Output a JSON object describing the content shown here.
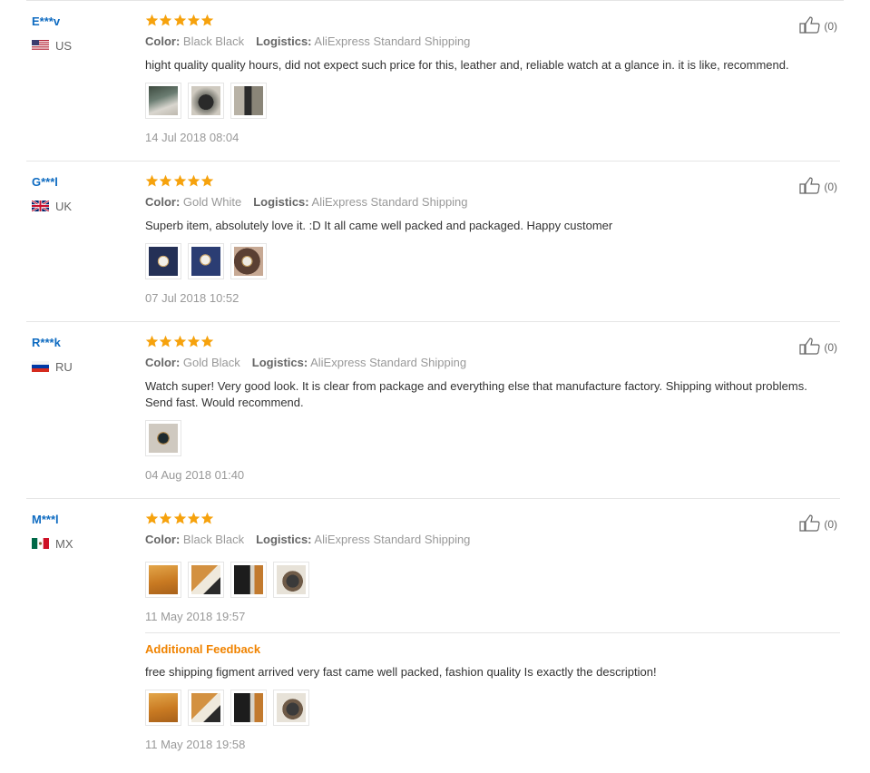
{
  "labels": {
    "color": "Color:",
    "logistics": "Logistics:",
    "additional_feedback": "Additional Feedback"
  },
  "colors": {
    "star": "#f6a20d",
    "username": "#0e6bc1",
    "accent": "#f08300"
  },
  "reviews": [
    {
      "user": "E***v",
      "country": "US",
      "flag": "us-flag-icon",
      "rating": 5,
      "color": "Black Black",
      "logistics": "AliExpress Standard Shipping",
      "text": "hight quality quality hours, did not expect such price for this, leather and, reliable watch at a glance in. it is like, recommend.",
      "thumb_count": 3,
      "date": "14 Jul 2018 08:04",
      "helpful": "(0)"
    },
    {
      "user": "G***l",
      "country": "UK",
      "flag": "uk-flag-icon",
      "rating": 5,
      "color": "Gold White",
      "logistics": "AliExpress Standard Shipping",
      "text": "Superb item, absolutely love it. :D It all came well packed and packaged. Happy customer",
      "thumb_count": 3,
      "date": "07 Jul 2018 10:52",
      "helpful": "(0)"
    },
    {
      "user": "R***k",
      "country": "RU",
      "flag": "ru-flag-icon",
      "rating": 5,
      "color": "Gold Black",
      "logistics": "AliExpress Standard Shipping",
      "text": "Watch super! Very good look. It is clear from package and everything else that manufacture factory. Shipping without problems. Send fast. Would recommend.",
      "thumb_count": 1,
      "date": "04 Aug 2018 01:40",
      "helpful": "(0)"
    },
    {
      "user": "M***l",
      "country": "MX",
      "flag": "mx-flag-icon",
      "rating": 5,
      "color": "Black Black",
      "logistics": "AliExpress Standard Shipping",
      "text": "",
      "thumb_count": 4,
      "date": "11 May 2018 19:57",
      "helpful": "(0)",
      "additional": {
        "text": "free shipping figment arrived very fast came well packed, fashion quality Is exactly the description!",
        "thumb_count": 4,
        "date": "11 May 2018 19:58"
      }
    }
  ]
}
